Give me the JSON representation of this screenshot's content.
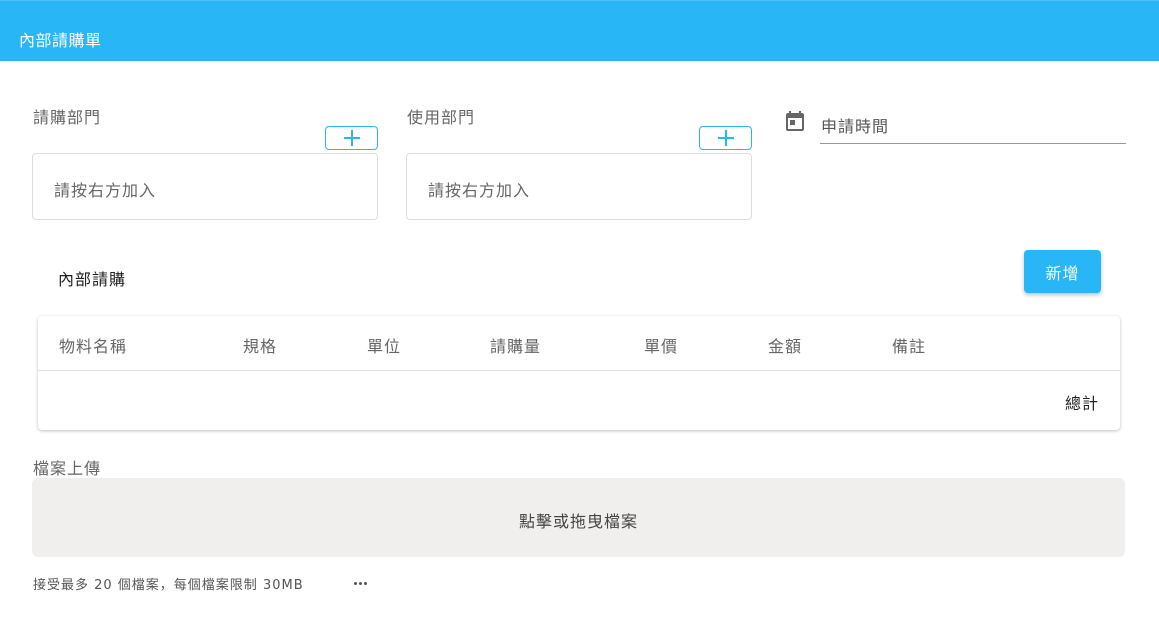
{
  "header": {
    "title": "內部請購單"
  },
  "form": {
    "request_dept": {
      "label": "請購部門",
      "placeholder": "請按右方加入"
    },
    "use_dept": {
      "label": "使用部門",
      "placeholder": "請按右方加入"
    },
    "apply_time": {
      "placeholder": "申請時間"
    }
  },
  "items": {
    "title": "內部請購",
    "new_label": "新增",
    "columns": [
      "物料名稱",
      "規格",
      "單位",
      "請購量",
      "單價",
      "金額",
      "備註"
    ],
    "total_label": "總計"
  },
  "upload": {
    "label": "檔案上傳",
    "dropzone_text": "點擊或拖曳檔案",
    "hint": "接受最多 20 個檔案，每個檔案限制 30MB"
  },
  "icons": {
    "add": "plus-icon",
    "calendar": "calendar-icon",
    "more": "more-horizontal-icon"
  },
  "colors": {
    "accent": "#29b6f6",
    "dropzone_bg": "#f0efed"
  }
}
